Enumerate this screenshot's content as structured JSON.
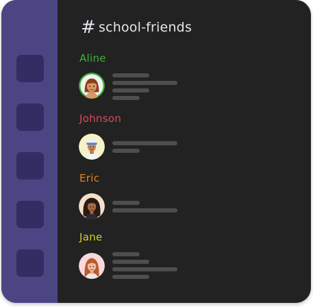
{
  "channel": {
    "hash_symbol": "#",
    "name": "school-friends"
  },
  "sidebar": {
    "servers": [
      "server-1",
      "server-2",
      "server-3",
      "server-4",
      "server-5"
    ]
  },
  "messages": [
    {
      "username": "Aline",
      "color": "#3cb33c"
    },
    {
      "username": "Johnson",
      "color": "#e0465a"
    },
    {
      "username": "Eric",
      "color": "#e8821e"
    },
    {
      "username": "Jane",
      "color": "#d7d21e"
    }
  ],
  "colors": {
    "sidebar": "#4b4584",
    "server_icon": "#342d64",
    "background": "#222222",
    "placeholder_line": "#4e4e4e"
  }
}
